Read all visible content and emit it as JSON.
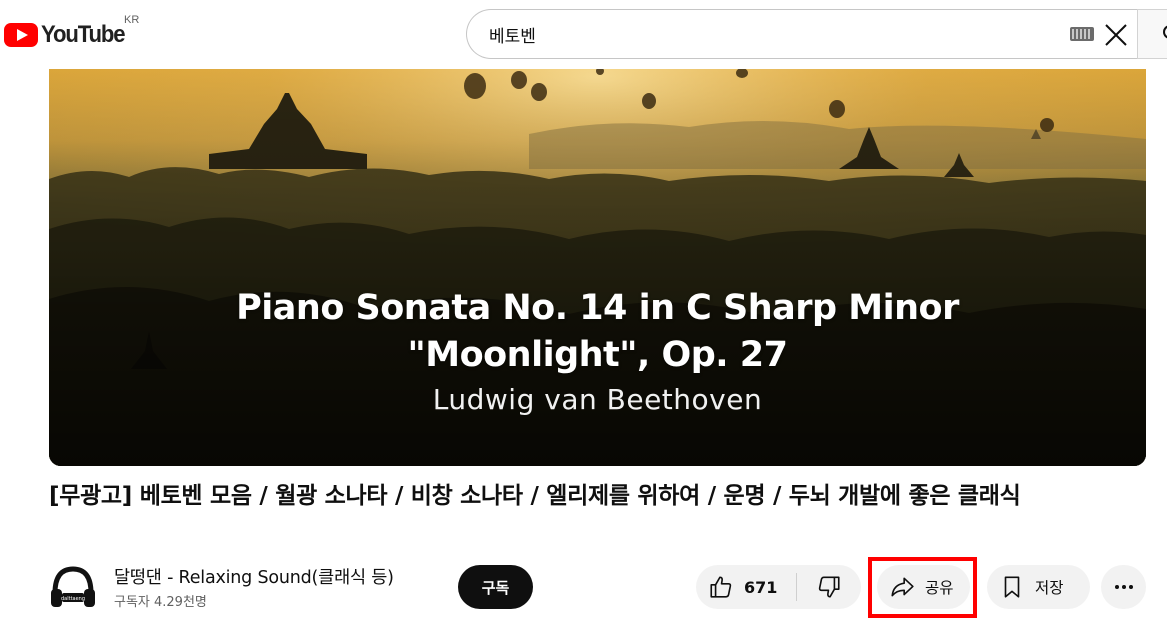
{
  "header": {
    "logo_text": "YouTube",
    "region": "KR",
    "search_value": "베토벤",
    "icons": {
      "logo": "youtube-logo-icon",
      "keyboard": "keyboard-icon",
      "clear": "close-icon",
      "search": "search-icon"
    }
  },
  "player": {
    "overlay_line1": "Piano Sonata No. 14 in C Sharp Minor",
    "overlay_line2": "\"Moonlight\", Op. 27",
    "overlay_line3": "Ludwig van Beethoven"
  },
  "video": {
    "title": "[무광고] 베토벤 모음 / 월광 소나타 / 비창 소나타 / 엘리제를 위하여 / 운명 / 두뇌 개발에 좋은 클래식"
  },
  "channel": {
    "name": "달떵댄 - Relaxing Sound(클래식 등)",
    "subscribers": "구독자 4.29천명",
    "subscribe_label": "구독",
    "avatar_text": "dalttaeng"
  },
  "actions": {
    "like_count": "671",
    "share_label": "공유",
    "save_label": "저장",
    "icons": {
      "like": "thumbs-up-icon",
      "dislike": "thumbs-down-icon",
      "share": "share-arrow-icon",
      "save": "bookmark-icon",
      "more": "more-horizontal-icon"
    }
  },
  "colors": {
    "brand_red": "#ff0000",
    "highlight": "#ff0000",
    "pill_bg": "#f2f2f2",
    "subscribe_bg": "#0f0f0f"
  }
}
